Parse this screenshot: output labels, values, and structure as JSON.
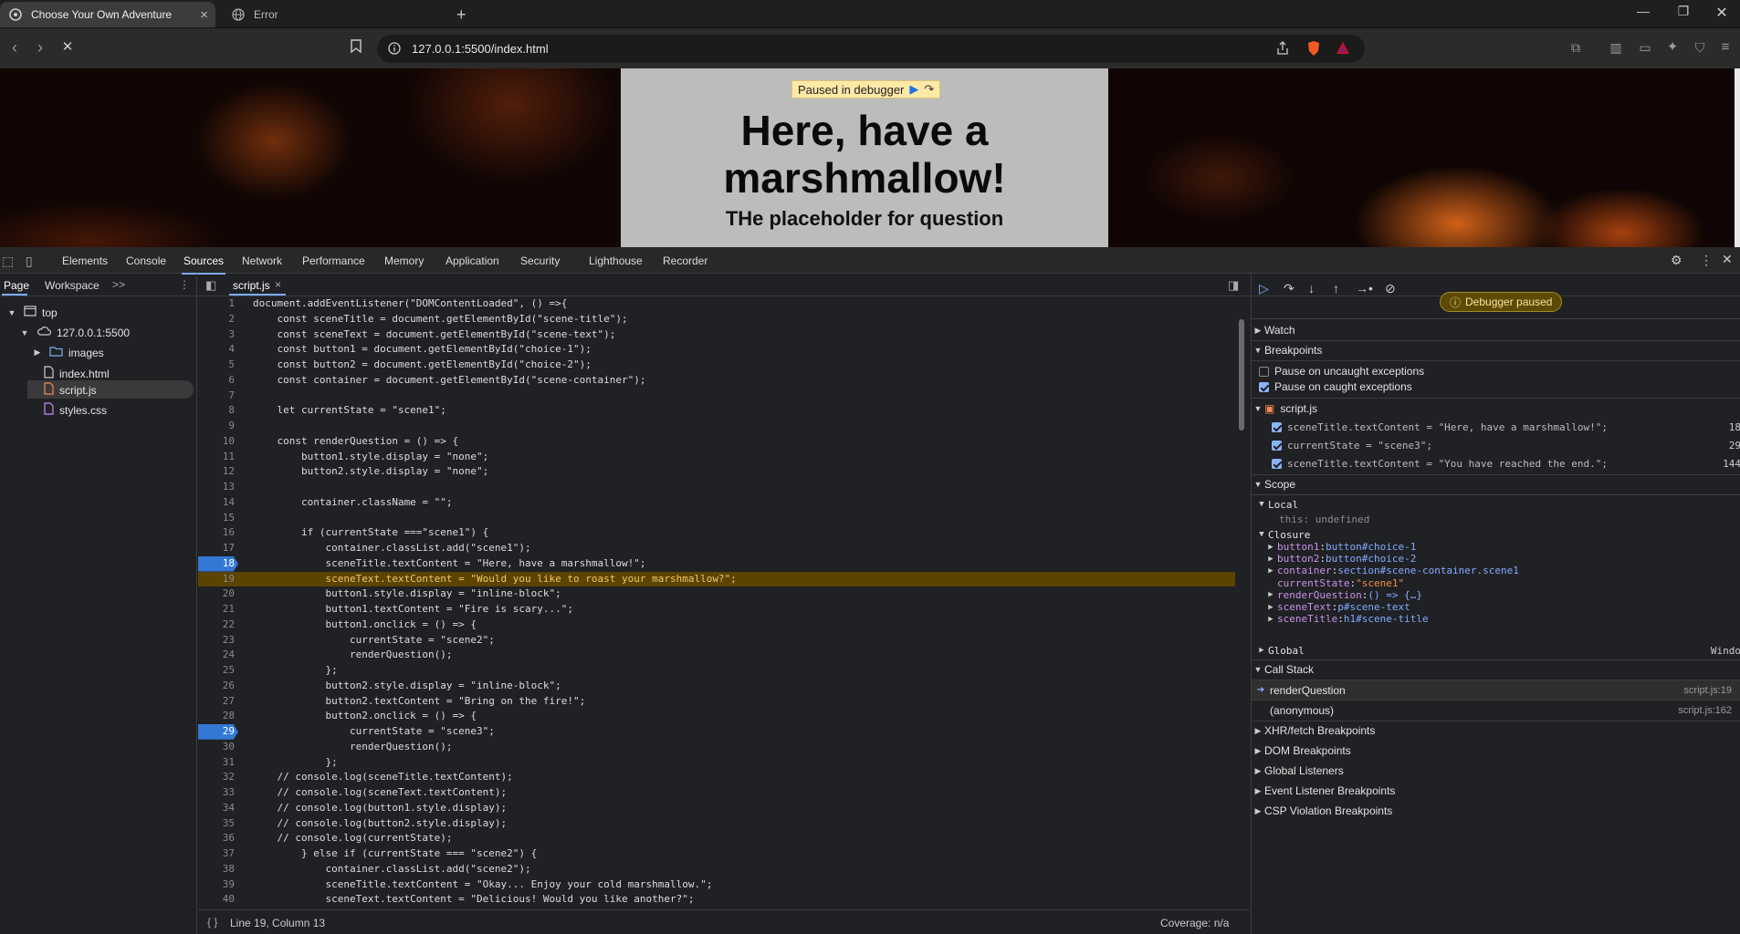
{
  "browser": {
    "tabs": [
      {
        "title": "Choose Your Own Adventure",
        "active": true
      },
      {
        "title": "Error",
        "active": false
      }
    ],
    "new_tab_label": "+",
    "url": "127.0.0.1:5500/index.html"
  },
  "page": {
    "paused_banner": "Paused in debugger",
    "title": "Here, have a marshmallow!",
    "question": "THe placeholder for question"
  },
  "devtools": {
    "tabs": [
      "Elements",
      "Console",
      "Sources",
      "Network",
      "Performance",
      "Memory",
      "Application",
      "Security",
      "Lighthouse",
      "Recorder"
    ],
    "active_tab": "Sources",
    "navigator": {
      "tabs": [
        "Page",
        "Workspace"
      ],
      "more": ">>",
      "tree": {
        "top": "top",
        "origin": "127.0.0.1:5500",
        "folder": "images",
        "files": [
          "index.html",
          "script.js",
          "styles.css"
        ]
      }
    },
    "editor": {
      "file_tab": "script.js",
      "status_position": "Line 19, Column 13",
      "coverage": "Coverage: n/a",
      "lines": [
        {
          "n": "1",
          "code": "document.addEventListener(\"DOMContentLoaded\", () =>{"
        },
        {
          "n": "2",
          "code": "    const sceneTitle = document.getElementById(\"scene-title\");"
        },
        {
          "n": "3",
          "code": "    const sceneText = document.getElementById(\"scene-text\");"
        },
        {
          "n": "4",
          "code": "    const button1 = document.getElementById(\"choice-1\");"
        },
        {
          "n": "5",
          "code": "    const button2 = document.getElementById(\"choice-2\");"
        },
        {
          "n": "6",
          "code": "    const container = document.getElementById(\"scene-container\");"
        },
        {
          "n": "7",
          "code": ""
        },
        {
          "n": "8",
          "code": "    let currentState = \"scene1\";"
        },
        {
          "n": "9",
          "code": ""
        },
        {
          "n": "10",
          "code": "    const renderQuestion = () => {"
        },
        {
          "n": "11",
          "code": "        button1.style.display = \"none\";"
        },
        {
          "n": "12",
          "code": "        button2.style.display = \"none\";"
        },
        {
          "n": "13",
          "code": ""
        },
        {
          "n": "14",
          "code": "        container.className = \"\";"
        },
        {
          "n": "15",
          "code": ""
        },
        {
          "n": "16",
          "code": "        if (currentState ===\"scene1\") {"
        },
        {
          "n": "17",
          "code": "            container.classList.add(\"scene1\");"
        },
        {
          "n": "18",
          "code": "            sceneTitle.textContent = \"Here, have a marshmallow!\";"
        },
        {
          "n": "19",
          "code": "            sceneText.textContent = \"Would you like to roast your marshmallow?\";"
        },
        {
          "n": "20",
          "code": "            button1.style.display = \"inline-block\";"
        },
        {
          "n": "21",
          "code": "            button1.textContent = \"Fire is scary...\";"
        },
        {
          "n": "22",
          "code": "            button1.onclick = () => {"
        },
        {
          "n": "23",
          "code": "                currentState = \"scene2\";"
        },
        {
          "n": "24",
          "code": "                renderQuestion();"
        },
        {
          "n": "25",
          "code": "            };"
        },
        {
          "n": "26",
          "code": "            button2.style.display = \"inline-block\";"
        },
        {
          "n": "27",
          "code": "            button2.textContent = \"Bring on the fire!\";"
        },
        {
          "n": "28",
          "code": "            button2.onclick = () => {"
        },
        {
          "n": "29",
          "code": "                currentState = \"scene3\";"
        },
        {
          "n": "30",
          "code": "                renderQuestion();"
        },
        {
          "n": "31",
          "code": "            };"
        },
        {
          "n": "32",
          "code": "    // console.log(sceneTitle.textContent);"
        },
        {
          "n": "33",
          "code": "    // console.log(sceneText.textContent);"
        },
        {
          "n": "34",
          "code": "    // console.log(button1.style.display);"
        },
        {
          "n": "35",
          "code": "    // console.log(button2.style.display);"
        },
        {
          "n": "36",
          "code": "    // console.log(currentState);"
        },
        {
          "n": "37",
          "code": "        } else if (currentState === \"scene2\") {"
        },
        {
          "n": "38",
          "code": "            container.classList.add(\"scene2\");"
        },
        {
          "n": "39",
          "code": "            sceneTitle.textContent = \"Okay... Enjoy your cold marshmallow.\";"
        },
        {
          "n": "40",
          "code": "            sceneText.textContent = \"Delicious! Would you like another?\";"
        }
      ],
      "breakpoint_lines": [
        "18",
        "29"
      ],
      "current_line": "19"
    },
    "debugger": {
      "paused_pill": "Debugger paused",
      "watch": "Watch",
      "breakpoints": "Breakpoints",
      "pause_uncaught": "Pause on uncaught exceptions",
      "pause_caught": "Pause on caught exceptions",
      "bp_file": "script.js",
      "bp_items": [
        {
          "code": "sceneTitle.textContent = \"Here, have a marshmallow!\";",
          "line": "18"
        },
        {
          "code": "currentState = \"scene3\";",
          "line": "29"
        },
        {
          "code": "sceneTitle.textContent = \"You have reached the end.\";",
          "line": "144"
        }
      ],
      "scope": "Scope",
      "local": "Local",
      "this_row": "this: undefined",
      "closure": "Closure",
      "closure_items": [
        {
          "k": "button1",
          "v": "button#choice-1",
          "expandable": true
        },
        {
          "k": "button2",
          "v": "button#choice-2",
          "expandable": true
        },
        {
          "k": "container",
          "v": "section#scene-container.scene1",
          "expandable": true
        },
        {
          "k": "currentState",
          "v": "\"scene1\"",
          "expandable": false
        },
        {
          "k": "renderQuestion",
          "v": "() => {…}",
          "expandable": true
        },
        {
          "k": "sceneText",
          "v": "p#scene-text",
          "expandable": true
        },
        {
          "k": "sceneTitle",
          "v": "h1#scene-title",
          "expandable": true
        }
      ],
      "global": "Global",
      "global_value": "Windo",
      "call_stack": "Call Stack",
      "frames": [
        {
          "name": "renderQuestion",
          "loc": "script.js:19"
        },
        {
          "name": "(anonymous)",
          "loc": "script.js:162"
        }
      ],
      "more_sections": [
        "XHR/fetch Breakpoints",
        "DOM Breakpoints",
        "Global Listeners",
        "Event Listener Breakpoints",
        "CSP Violation Breakpoints"
      ]
    }
  },
  "colors": {
    "accent": "#7cacf8",
    "breakpoint": "#3478d6",
    "paused_line": "#5a4400"
  }
}
